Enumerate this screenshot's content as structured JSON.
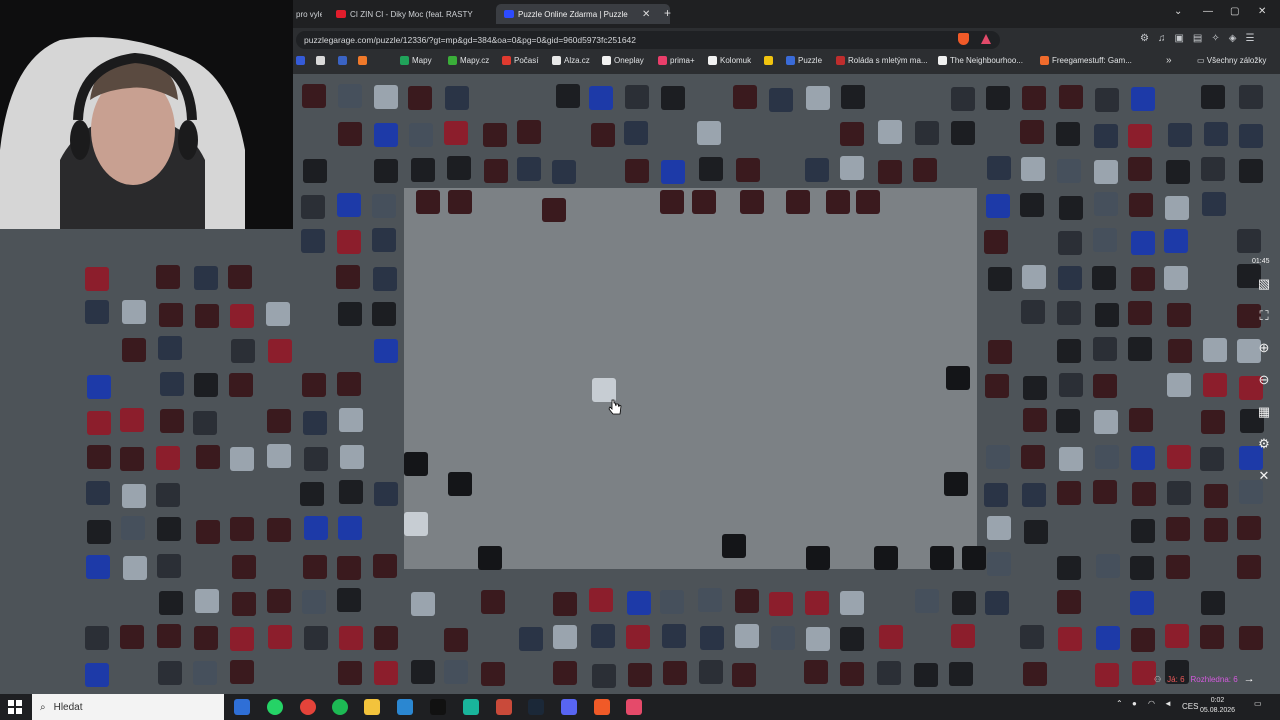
{
  "browser": {
    "tabs": [
      {
        "label": "pro vyle",
        "favicon_color": "#4a4d52"
      },
      {
        "label": "CI ZIN CI - Diky Moc (feat. RASTY",
        "favicon_color": "#e11d2c"
      },
      {
        "label": "Puzzle Online Zdarma | Puzzle",
        "favicon_color": "#2d4bff"
      }
    ],
    "new_tab": "+",
    "url": "puzzlegarage.com/puzzle/12336/?gt=mp&gd=384&oa=0&pg=0&gid=960d5973fc251642",
    "bookmarks": [
      {
        "label": "",
        "color": "#355bd8"
      },
      {
        "label": "",
        "color": "#d9d9d9"
      },
      {
        "label": "",
        "color": "#3a63c4"
      },
      {
        "label": "",
        "color": "#f0792a"
      },
      {
        "label": "Mapy",
        "color": "#20a35a"
      },
      {
        "label": "Mapy.cz",
        "color": "#3aae39"
      },
      {
        "label": "Počasí",
        "color": "#e03a2f"
      },
      {
        "label": "Alza.cz",
        "color": "#e8e8e8"
      },
      {
        "label": "Oneplay",
        "color": "#f2f2f2"
      },
      {
        "label": "prima+",
        "color": "#ea3e6a"
      },
      {
        "label": "Kolomuk",
        "color": "#f2f2f2"
      },
      {
        "label": "",
        "color": "#f1c40f"
      },
      {
        "label": "Puzzle",
        "color": "#3a6bd8"
      },
      {
        "label": "Roláda s mletým ma...",
        "color": "#bf2d2d"
      },
      {
        "label": "The Neighbourhoo...",
        "color": "#f0f0f0"
      },
      {
        "label": "Freegamestuff: Gam...",
        "color": "#f06b2c"
      }
    ],
    "more_bookmarks": "»",
    "all_bookmarks": "Všechny záložky"
  },
  "puzzle": {
    "timer": "01:45",
    "status_me": "Já: 6",
    "status_viewers": "Rozhledna: 6"
  },
  "taskbar": {
    "search_placeholder": "Hledat",
    "language": "CES",
    "time": "0:02",
    "date": "05.08.2026"
  },
  "icons": [
    "windows-start-icon",
    "search-icon",
    "cursor-hand-icon",
    "image-preview-icon",
    "fullscreen-icon",
    "zoom-in-icon",
    "zoom-out-icon",
    "grid-icon",
    "settings-icon",
    "close-icon",
    "next-arrow-icon"
  ]
}
